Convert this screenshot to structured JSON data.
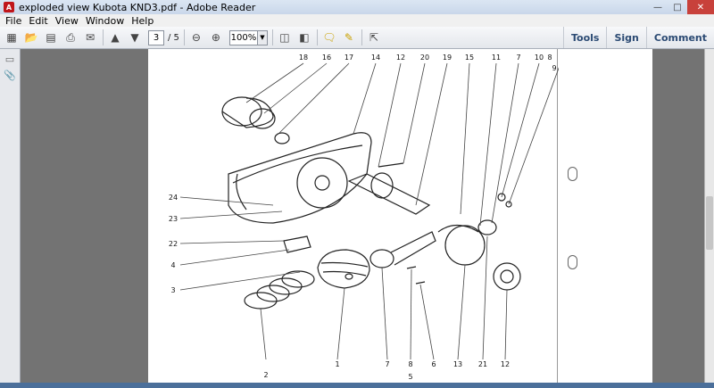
{
  "window": {
    "title": "exploded view Kubota KND3.pdf - Adobe Reader",
    "app_icon": "adobe-reader-icon"
  },
  "menu": [
    "File",
    "Edit",
    "View",
    "Window",
    "Help"
  ],
  "toolbar": {
    "page_current": "3",
    "page_total": "/ 5",
    "zoom": "100%"
  },
  "right_buttons": [
    "Tools",
    "Sign",
    "Comment"
  ],
  "drawing": {
    "callouts_top": [
      "18",
      "16",
      "17",
      "14",
      "12",
      "20",
      "19",
      "15",
      "11",
      "7",
      "10",
      "8",
      "9"
    ],
    "callouts_left": [
      "24",
      "23",
      "22",
      "4",
      "3"
    ],
    "callouts_bottom": [
      "2",
      "1",
      "7",
      "8",
      "6",
      "13",
      "21",
      "12",
      "5"
    ]
  }
}
